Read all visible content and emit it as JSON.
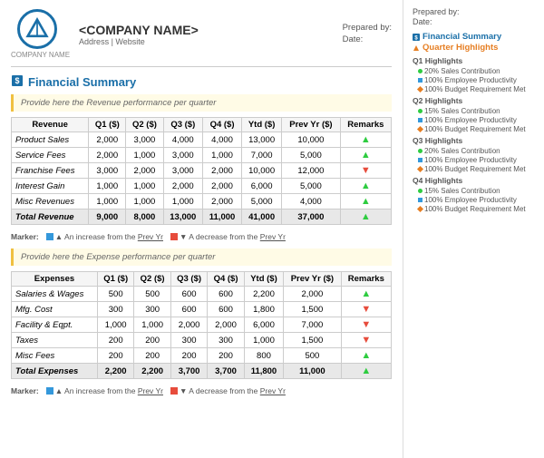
{
  "header": {
    "company_name": "<COMPANY NAME>",
    "address": "Address | Website",
    "company_label": "COMPANY NAME",
    "prepared_by_label": "Prepared by:",
    "date_label": "Date:"
  },
  "section_title": "Financial Summary",
  "note_revenue": "Provide here the Revenue performance per quarter",
  "note_expense": "Provide here the Expense performance per quarter",
  "revenue_table": {
    "headers": [
      "Revenue",
      "Q1 ($)",
      "Q2 ($)",
      "Q3 ($)",
      "Q4 ($)",
      "Ytd ($)",
      "Prev Yr ($)",
      "Remarks"
    ],
    "rows": [
      [
        "Product Sales",
        "2,000",
        "3,000",
        "4,000",
        "4,000",
        "13,000",
        "10,000",
        "up"
      ],
      [
        "Service Fees",
        "2,000",
        "1,000",
        "3,000",
        "1,000",
        "7,000",
        "5,000",
        "up"
      ],
      [
        "Franchise Fees",
        "3,000",
        "2,000",
        "3,000",
        "2,000",
        "10,000",
        "12,000",
        "down"
      ],
      [
        "Interest Gain",
        "1,000",
        "1,000",
        "2,000",
        "2,000",
        "6,000",
        "5,000",
        "up"
      ],
      [
        "Misc Revenues",
        "1,000",
        "1,000",
        "1,000",
        "2,000",
        "5,000",
        "4,000",
        "up"
      ]
    ],
    "total_row": [
      "Total Revenue",
      "9,000",
      "8,000",
      "13,000",
      "11,000",
      "41,000",
      "37,000",
      "up"
    ]
  },
  "expense_table": {
    "headers": [
      "Expenses",
      "Q1 ($)",
      "Q2 ($)",
      "Q3 ($)",
      "Q4 ($)",
      "Ytd ($)",
      "Prev Yr ($)",
      "Remarks"
    ],
    "rows": [
      [
        "Salaries & Wages",
        "500",
        "500",
        "600",
        "600",
        "2,200",
        "2,000",
        "up"
      ],
      [
        "Mfg. Cost",
        "300",
        "300",
        "600",
        "600",
        "1,800",
        "1,500",
        "down"
      ],
      [
        "Facility & Eqpt.",
        "1,000",
        "1,000",
        "2,000",
        "2,000",
        "6,000",
        "7,000",
        "down"
      ],
      [
        "Taxes",
        "200",
        "200",
        "300",
        "300",
        "1,000",
        "1,500",
        "down"
      ],
      [
        "Misc Fees",
        "200",
        "200",
        "200",
        "200",
        "800",
        "500",
        "up"
      ]
    ],
    "total_row": [
      "Total Expenses",
      "2,200",
      "2,200",
      "3,700",
      "3,700",
      "11,800",
      "11,000",
      "up"
    ]
  },
  "marker": {
    "label_increase": "An increase from the Prev Yr",
    "label_decrease": "A decrease from the Prev Yr"
  },
  "right_panel": {
    "prepared_by_label": "Prepared by:",
    "date_label": "Date:",
    "financial_summary_link": "Financial Summary",
    "quarter_highlights_link": "Quarter Highlights",
    "q1": {
      "title": "Q1 Highlights",
      "items": [
        "20% Sales Contribution",
        "100% Employee Productivity",
        "100% Budget Requirement Met"
      ]
    },
    "q2": {
      "title": "Q2 Highlights",
      "items": [
        "15% Sales Contribution",
        "100% Employee Productivity",
        "100% Budget Requirement Met"
      ]
    },
    "q3": {
      "title": "Q3 Highlights",
      "items": [
        "20% Sales Contribution",
        "100% Employee Productivity",
        "100% Budget Requirement Met"
      ]
    },
    "q4": {
      "title": "Q4 Highlights",
      "items": [
        "15% Sales Contribution",
        "100% Employee Productivity",
        "100% Budget Requirement Met"
      ]
    }
  }
}
